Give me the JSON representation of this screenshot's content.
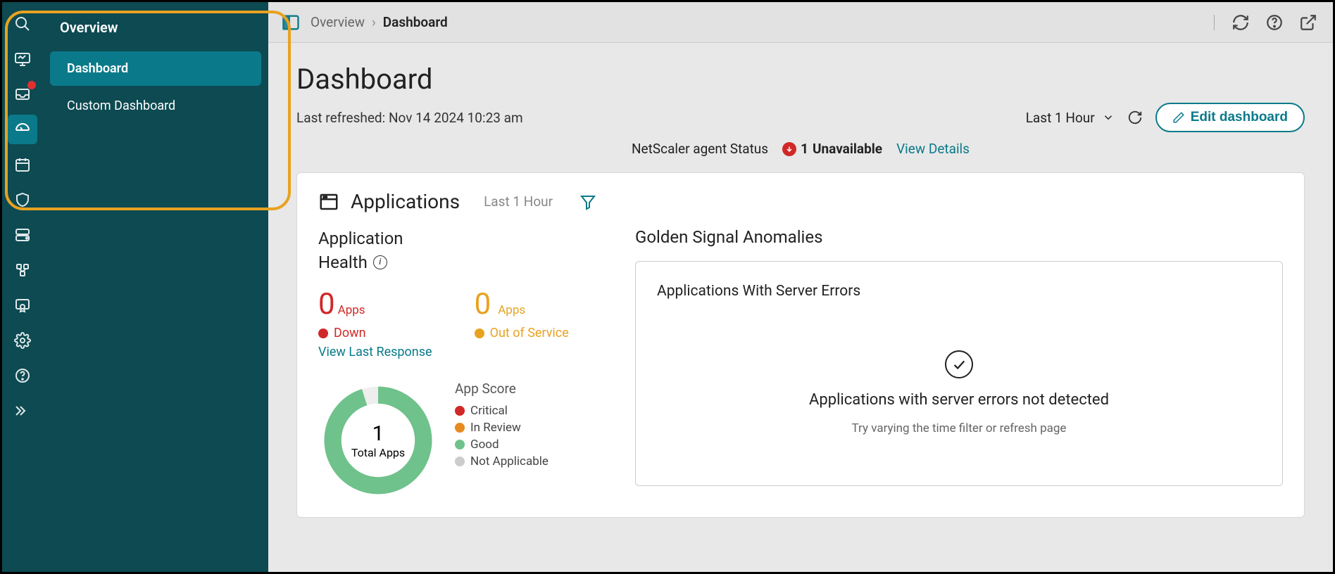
{
  "sidebar": {
    "title": "Overview",
    "items": [
      {
        "label": "Dashboard",
        "active": true
      },
      {
        "label": "Custom Dashboard",
        "active": false
      }
    ]
  },
  "breadcrumb": {
    "root": "Overview",
    "current": "Dashboard"
  },
  "page": {
    "title": "Dashboard",
    "refreshed_label": "Last refreshed: Nov 14 2024 10:23 am",
    "time_range": "Last 1 Hour",
    "edit_label": "Edit dashboard"
  },
  "agent": {
    "label": "NetScaler agent Status",
    "count": "1",
    "status": "Unavailable",
    "link": "View Details"
  },
  "applications": {
    "title": "Applications",
    "time_range": "Last 1 Hour",
    "health_title_line1": "Application",
    "health_title_line2": "Health",
    "down_count": "0",
    "down_apps": "Apps",
    "down_label": "Down",
    "down_link": "View Last Response",
    "oos_count": "0",
    "oos_apps": "Apps",
    "oos_label": "Out of Service",
    "donut_total": "1",
    "donut_label": "Total Apps",
    "legend_title": "App Score",
    "legend": [
      {
        "label": "Critical",
        "color": "#d02828"
      },
      {
        "label": "In Review",
        "color": "#e88a20"
      },
      {
        "label": "Good",
        "color": "#6fc28b"
      },
      {
        "label": "Not Applicable",
        "color": "#cccccc"
      }
    ]
  },
  "anomalies": {
    "title": "Golden Signal Anomalies",
    "box_title": "Applications With Server Errors",
    "empty_msg": "Applications with server errors not detected",
    "empty_hint": "Try varying the time filter or refresh page"
  }
}
